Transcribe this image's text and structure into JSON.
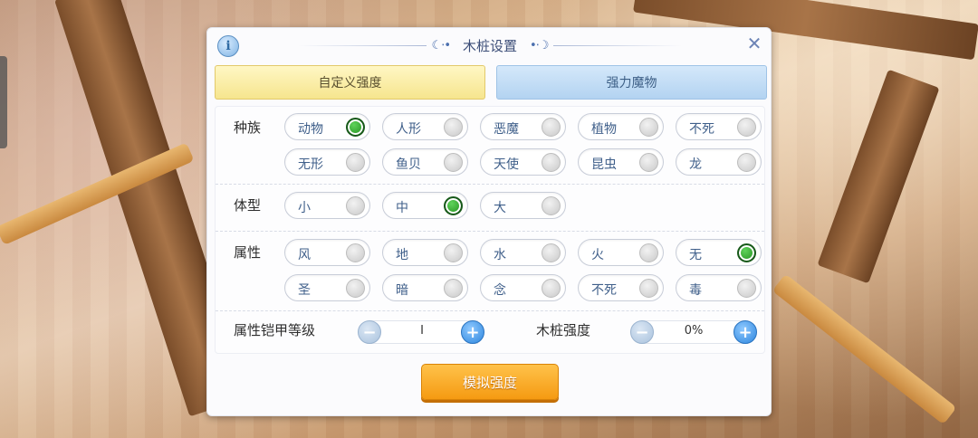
{
  "dialog": {
    "title": "木桩设置",
    "info_icon": "info-icon",
    "close_icon": "close-icon"
  },
  "tabs": [
    {
      "label": "自定义强度",
      "active": true
    },
    {
      "label": "强力魔物",
      "active": false
    }
  ],
  "race": {
    "label": "种族",
    "options": [
      {
        "label": "动物",
        "selected": true
      },
      {
        "label": "人形",
        "selected": false
      },
      {
        "label": "恶魔",
        "selected": false
      },
      {
        "label": "植物",
        "selected": false
      },
      {
        "label": "不死",
        "selected": false
      },
      {
        "label": "无形",
        "selected": false
      },
      {
        "label": "鱼贝",
        "selected": false
      },
      {
        "label": "天使",
        "selected": false
      },
      {
        "label": "昆虫",
        "selected": false
      },
      {
        "label": "龙",
        "selected": false
      }
    ]
  },
  "size": {
    "label": "体型",
    "options": [
      {
        "label": "小",
        "selected": false
      },
      {
        "label": "中",
        "selected": true
      },
      {
        "label": "大",
        "selected": false
      }
    ]
  },
  "element": {
    "label": "属性",
    "options": [
      {
        "label": "风",
        "selected": false
      },
      {
        "label": "地",
        "selected": false
      },
      {
        "label": "水",
        "selected": false
      },
      {
        "label": "火",
        "selected": false
      },
      {
        "label": "无",
        "selected": true
      },
      {
        "label": "圣",
        "selected": false
      },
      {
        "label": "暗",
        "selected": false
      },
      {
        "label": "念",
        "selected": false
      },
      {
        "label": "不死",
        "selected": false
      },
      {
        "label": "毒",
        "selected": false
      }
    ]
  },
  "armor_level": {
    "label": "属性铠甲等级",
    "value": "I"
  },
  "dummy_strength": {
    "label": "木桩强度",
    "value": "0%"
  },
  "simulate_button": {
    "label": "模拟强度"
  },
  "colors": {
    "accent_orange": "#f59a12",
    "selected_green": "#1f8a1a",
    "tab_active": "#f6e58e",
    "tab_inactive": "#b3d3f1"
  }
}
